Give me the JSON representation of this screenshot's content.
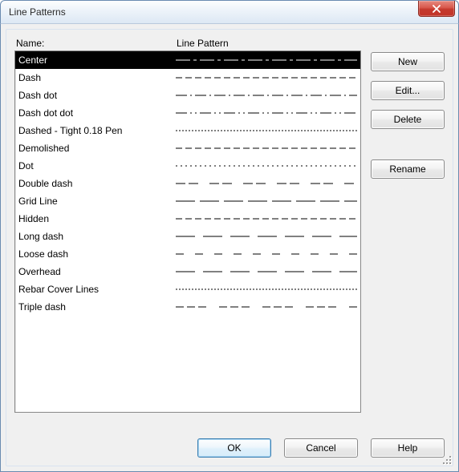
{
  "window": {
    "title": "Line Patterns"
  },
  "headers": {
    "name": "Name:",
    "pattern": "Line Pattern"
  },
  "patterns": [
    {
      "name": "Center",
      "style": "center",
      "selected": true
    },
    {
      "name": "Dash",
      "style": "dash",
      "selected": false
    },
    {
      "name": "Dash dot",
      "style": "dashdot",
      "selected": false
    },
    {
      "name": "Dash dot dot",
      "style": "dashdotdot",
      "selected": false
    },
    {
      "name": "Dashed - Tight 0.18 Pen",
      "style": "tight",
      "selected": false
    },
    {
      "name": "Demolished",
      "style": "dash",
      "selected": false
    },
    {
      "name": "Dot",
      "style": "dot",
      "selected": false
    },
    {
      "name": "Double dash",
      "style": "doubledash",
      "selected": false
    },
    {
      "name": "Grid Line",
      "style": "griddash",
      "selected": false
    },
    {
      "name": "Hidden",
      "style": "dash",
      "selected": false
    },
    {
      "name": "Long dash",
      "style": "longdash",
      "selected": false
    },
    {
      "name": "Loose dash",
      "style": "loosedash",
      "selected": false
    },
    {
      "name": "Overhead",
      "style": "longdash",
      "selected": false
    },
    {
      "name": "Rebar Cover Lines",
      "style": "tight",
      "selected": false
    },
    {
      "name": "Triple dash",
      "style": "tripledash",
      "selected": false
    }
  ],
  "sideButtons": {
    "new": "New",
    "edit": "Edit...",
    "delete": "Delete",
    "rename": "Rename"
  },
  "bottomButtons": {
    "ok": "OK",
    "cancel": "Cancel",
    "help": "Help"
  }
}
